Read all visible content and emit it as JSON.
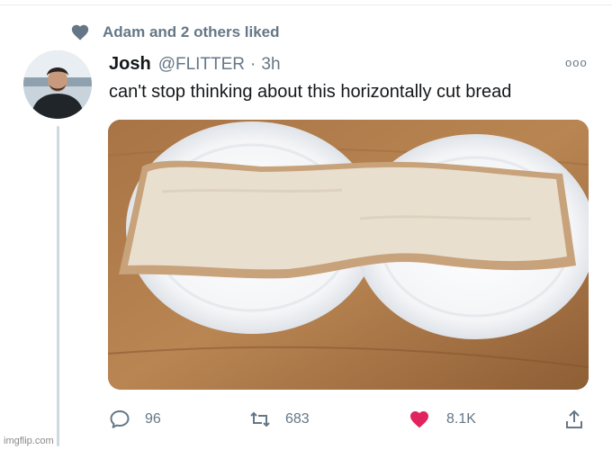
{
  "social_context": {
    "text": "Adam and 2 others liked",
    "icon": "heart-icon"
  },
  "tweet": {
    "author_name": "Josh",
    "handle": "@FLITTER",
    "separator": "·",
    "timestamp": "3h",
    "text": "can't stop thinking about this horizontally cut bread",
    "more_menu": "ooo"
  },
  "actions": {
    "replies": "96",
    "retweets": "683",
    "likes": "8.1K",
    "like_active": true
  },
  "colors": {
    "secondary_text": "#657786",
    "like_red": "#e0245e",
    "thread_line": "#cfd9de"
  },
  "watermark": "imgflip.com"
}
